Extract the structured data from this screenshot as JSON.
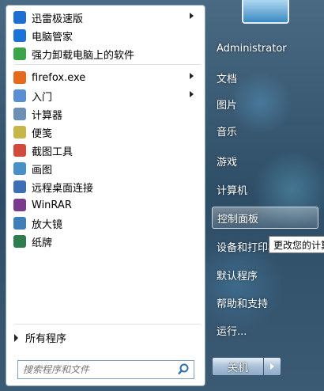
{
  "left": {
    "pinned": [
      {
        "label": "迅雷极速版",
        "icon": "xunlei-icon",
        "arrow": true,
        "color": "#1e6fd1"
      },
      {
        "label": "电脑管家",
        "icon": "shield-icon",
        "arrow": false,
        "color": "#1a73d9"
      },
      {
        "label": "强力卸载电脑上的软件",
        "icon": "uninstaller-icon",
        "arrow": false,
        "color": "#3aa54a"
      }
    ],
    "recent": [
      {
        "label": "firefox.exe",
        "icon": "firefox-icon",
        "arrow": true,
        "color": "#e66a1c"
      },
      {
        "label": "入门",
        "icon": "getting-started-icon",
        "arrow": true,
        "color": "#5a8fd6"
      },
      {
        "label": "计算器",
        "icon": "calculator-icon",
        "arrow": false,
        "color": "#6c8fb6"
      },
      {
        "label": "便笺",
        "icon": "sticky-notes-icon",
        "arrow": false,
        "color": "#c6b64a"
      },
      {
        "label": "截图工具",
        "icon": "snipping-tool-icon",
        "arrow": false,
        "color": "#d24b3a"
      },
      {
        "label": "画图",
        "icon": "paint-icon",
        "arrow": false,
        "color": "#4a90c8"
      },
      {
        "label": "远程桌面连接",
        "icon": "remote-desktop-icon",
        "arrow": false,
        "color": "#3c6fb5"
      },
      {
        "label": "WinRAR",
        "icon": "winrar-icon",
        "arrow": false,
        "color": "#7a3b8c"
      },
      {
        "label": "放大镜",
        "icon": "magnifier-icon",
        "arrow": false,
        "color": "#3f7fb9"
      },
      {
        "label": "纸牌",
        "icon": "solitaire-icon",
        "arrow": false,
        "color": "#2e7d4f"
      }
    ],
    "all_programs": "所有程序",
    "search_placeholder": "搜索程序和文件"
  },
  "right": {
    "items": [
      "Administrator",
      "文档",
      "图片",
      "音乐",
      "游戏",
      "计算机",
      "控制面板",
      "设备和打印机",
      "默认程序",
      "帮助和支持",
      "运行..."
    ],
    "tooltip": "更改您的计算机设置",
    "shutdown": "关机"
  }
}
